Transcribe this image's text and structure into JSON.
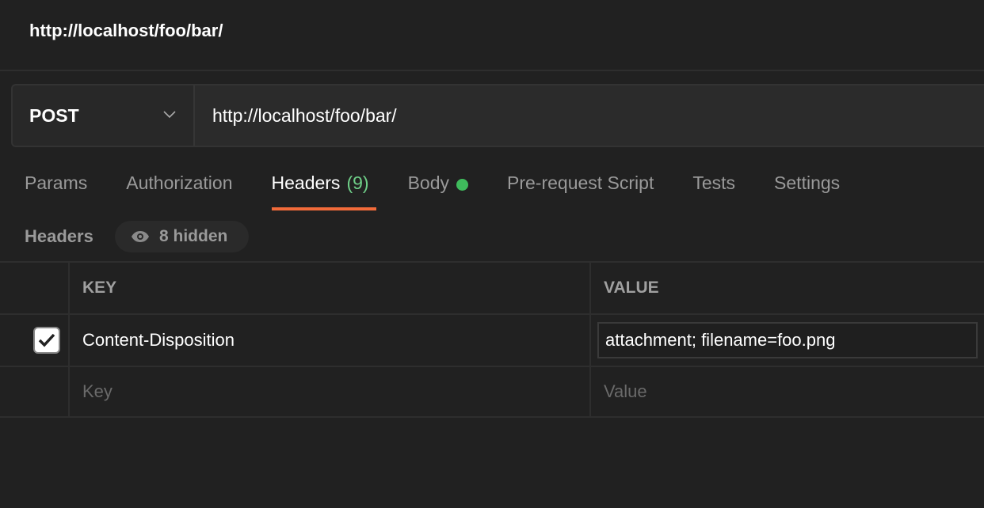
{
  "title": "http://localhost/foo/bar/",
  "request": {
    "method": "POST",
    "url": "http://localhost/foo/bar/"
  },
  "tabs": [
    {
      "label": "Params"
    },
    {
      "label": "Authorization"
    },
    {
      "label": "Headers",
      "count": "(9)",
      "active": true
    },
    {
      "label": "Body",
      "indicator": "green-dot"
    },
    {
      "label": "Pre-request Script"
    },
    {
      "label": "Tests"
    },
    {
      "label": "Settings"
    }
  ],
  "headers_section": {
    "label": "Headers",
    "hidden_label": "8 hidden",
    "hidden_icon": "eye-icon"
  },
  "table": {
    "columns": [
      "KEY",
      "VALUE"
    ],
    "rows": [
      {
        "checked": true,
        "key": "Content-Disposition",
        "value": "attachment; filename=foo.png"
      }
    ],
    "placeholder": {
      "key": "Key",
      "value": "Value"
    }
  },
  "colors": {
    "accent": "#f26b3a",
    "count": "#6fcf88",
    "indicator": "#3fbb5c",
    "background": "#212121"
  }
}
